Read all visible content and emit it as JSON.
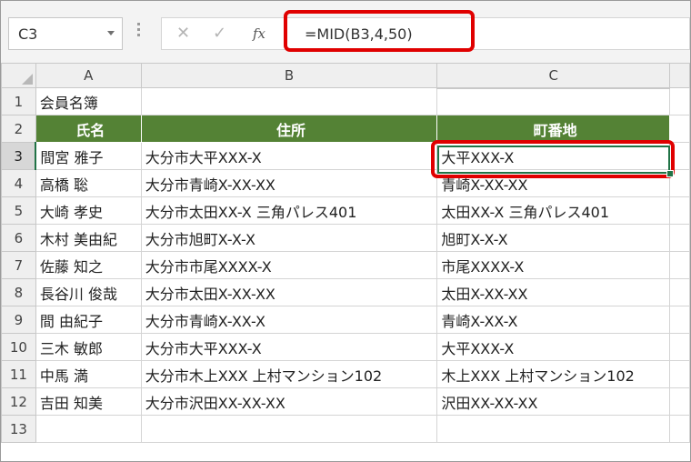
{
  "name_box": {
    "value": "C3"
  },
  "formula_bar": {
    "cancel_glyph": "✕",
    "enter_glyph": "✓",
    "fx_label": "fx",
    "formula": "=MID(B3,4,50)"
  },
  "columns": [
    "A",
    "B",
    "C"
  ],
  "selection": {
    "cell": "C3",
    "column": "C",
    "row": "3"
  },
  "accent_colors": {
    "header_fill": "#548235",
    "highlight": "#e00000",
    "selection": "#217346"
  },
  "rows": [
    {
      "num": "1",
      "cells": [
        "会員名簿",
        "",
        ""
      ]
    },
    {
      "num": "2",
      "cells": [
        "氏名",
        "住所",
        "町番地"
      ],
      "style": "green"
    },
    {
      "num": "3",
      "cells": [
        "間宮 雅子",
        "大分市大平XXX-X",
        "大平XXX-X"
      ]
    },
    {
      "num": "4",
      "cells": [
        "高橋 聡",
        "大分市青崎X-XX-XX",
        "青崎X-XX-XX"
      ]
    },
    {
      "num": "5",
      "cells": [
        "大崎 孝史",
        "大分市太田XX-X 三角パレス401",
        "太田XX-X 三角パレス401"
      ]
    },
    {
      "num": "6",
      "cells": [
        "木村 美由紀",
        "大分市旭町X-X-X",
        "旭町X-X-X"
      ]
    },
    {
      "num": "7",
      "cells": [
        "佐藤 知之",
        "大分市市尾XXXX-X",
        "市尾XXXX-X"
      ]
    },
    {
      "num": "8",
      "cells": [
        "長谷川 俊哉",
        "大分市太田X-XX-XX",
        "太田X-XX-XX"
      ]
    },
    {
      "num": "9",
      "cells": [
        "間 由紀子",
        "大分市青崎X-XX-X",
        "青崎X-XX-X"
      ]
    },
    {
      "num": "10",
      "cells": [
        "三木 敏郎",
        "大分市大平XXX-X",
        "大平XXX-X"
      ]
    },
    {
      "num": "11",
      "cells": [
        "中馬 満",
        "大分市木上XXX 上村マンション102",
        "木上XXX 上村マンション102"
      ]
    },
    {
      "num": "12",
      "cells": [
        "吉田 知美",
        "大分市沢田XX-XX-XX",
        "沢田XX-XX-XX"
      ]
    },
    {
      "num": "13",
      "cells": [
        "",
        "",
        ""
      ]
    }
  ]
}
